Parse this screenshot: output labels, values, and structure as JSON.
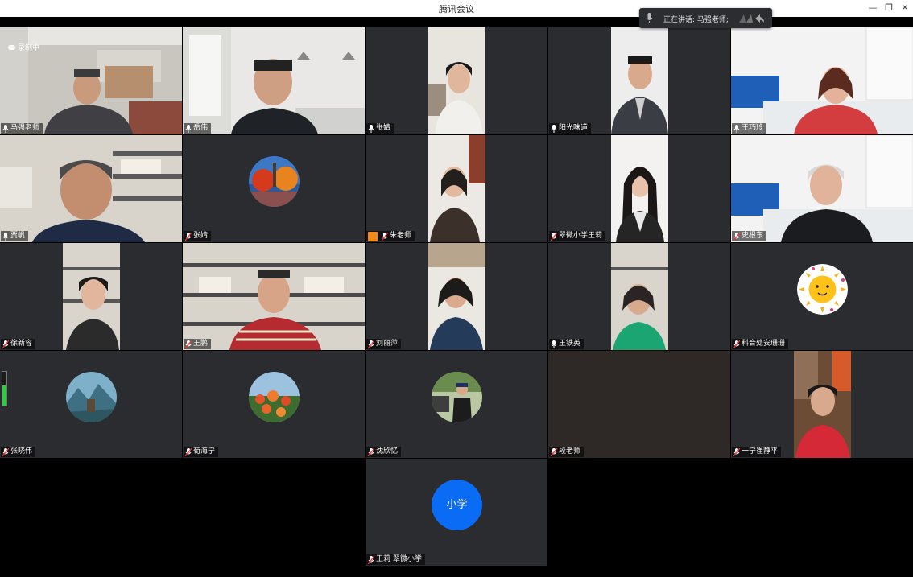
{
  "window": {
    "title": "腾讯会议",
    "minimize_glyph": "—",
    "restore_glyph": "❐",
    "close_glyph": "✕"
  },
  "speaking_now": {
    "label": "正在讲话: 马强老师;",
    "mic_icon": "mic-icon"
  },
  "recording": {
    "label": "录制中"
  },
  "participants": [
    {
      "name": "马强老师",
      "mic": "on"
    },
    {
      "name": "岳伟",
      "mic": "on"
    },
    {
      "name": "张婧",
      "mic": "on"
    },
    {
      "name": "阳光味道",
      "mic": "on"
    },
    {
      "name": "王巧玲",
      "mic": "on"
    },
    {
      "name": "贾帆",
      "mic": "on"
    },
    {
      "name": "张婧",
      "mic": "muted"
    },
    {
      "name": "朱老师",
      "mic": "muted",
      "host": true
    },
    {
      "name": "翠微小学王莉",
      "mic": "muted"
    },
    {
      "name": "史根东",
      "mic": "muted"
    },
    {
      "name": "徐新容",
      "mic": "muted"
    },
    {
      "name": "王鹏",
      "mic": "muted"
    },
    {
      "name": "刘丽萍",
      "mic": "muted"
    },
    {
      "name": "王铁英",
      "mic": "on"
    },
    {
      "name": "科合处安珊珊",
      "mic": "muted"
    },
    {
      "name": "张晓伟",
      "mic": "muted",
      "volume": 0.6
    },
    {
      "name": "荀海宁",
      "mic": "muted"
    },
    {
      "name": "沈欣忆",
      "mic": "muted"
    },
    {
      "name": "段老师",
      "mic": "muted"
    },
    {
      "name": "一宁崔静平",
      "mic": "muted"
    },
    {
      "name": "王莉 翠微小学",
      "mic": "muted",
      "avatar_text": "小学"
    }
  ],
  "colors": {
    "accent_blue": "#0a6cf5",
    "active_border": "#19c37d",
    "tile_bg": "#2a2c2f",
    "host_badge": "#f08a1c"
  }
}
